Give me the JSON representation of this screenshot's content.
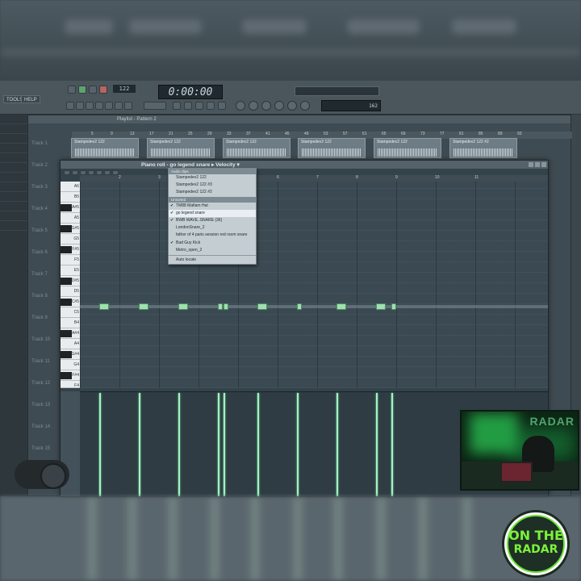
{
  "menu": {
    "tools": "TOOLS",
    "help": "HELP"
  },
  "transport": {
    "time": "0:00:00",
    "tempo": "122",
    "cpu": "162"
  },
  "playlist": {
    "title": "Playlist - Pattern 2",
    "ruler": [
      "5",
      "9",
      "13",
      "17",
      "21",
      "25",
      "29",
      "33",
      "37",
      "41",
      "45",
      "49",
      "53",
      "57",
      "61",
      "65",
      "69",
      "73",
      "77",
      "81",
      "85",
      "89",
      "93"
    ],
    "tracks": [
      "Track 1",
      "Track 2",
      "Track 3",
      "Track 4",
      "Track 5",
      "Track 6",
      "Track 7",
      "Track 8",
      "Track 9",
      "Track 10",
      "Track 11",
      "Track 12",
      "Track 13",
      "Track 14",
      "Track 15"
    ],
    "clips": [
      "Stampedev2 122",
      "Stampedev2 122",
      "Stampedev2 122",
      "Stampedev2 122",
      "Stampedev2 122",
      "Stampedev2 122 #2"
    ]
  },
  "piano_roll": {
    "title_prefix": "Piano roll - ",
    "channel": "go legend snare",
    "param": "Velocity",
    "ruler": [
      "2",
      "3",
      "4",
      "5",
      "6",
      "7",
      "8",
      "9",
      "10",
      "11"
    ],
    "keys": [
      "A6",
      "B5",
      "A#5",
      "A5",
      "G#5",
      "G5",
      "F#5",
      "F5",
      "E5",
      "D#5",
      "D5",
      "C#5",
      "C5",
      "B4",
      "A#4",
      "A4",
      "G#4",
      "G4",
      "F#4",
      "F4",
      "E4",
      "D#4",
      "D4",
      "C#4"
    ]
  },
  "dropdown": {
    "head1": "Audio clips",
    "group1": [
      "Stampedev2 122",
      "Stampedev2 122 #3",
      "Stampedev2 122 #2"
    ],
    "head2": "Unsorted",
    "group2": [
      {
        "label": "TM88 Mafiam Hat",
        "checked": true
      },
      {
        "label": "go legend snare",
        "checked": true,
        "selected": true
      },
      {
        "label": "BWB WAVE..SNARE (36)",
        "checked": true
      },
      {
        "label": "LondonSnare_2",
        "checked": false
      },
      {
        "label": "father of 4 paris session red room snare",
        "checked": false
      },
      {
        "label": "Bad Guy Kick",
        "checked": true
      },
      {
        "label": "Metro_open_2",
        "checked": false
      }
    ],
    "footer": "Auto locate"
  },
  "webcam": {
    "brand": "RADAR"
  },
  "logo": {
    "line1": "ON THE",
    "line2": "RADAR"
  },
  "colors": {
    "note": "#9fe0b0",
    "velocity": "#a7f0c2",
    "logo_green": "#7cf33a"
  }
}
